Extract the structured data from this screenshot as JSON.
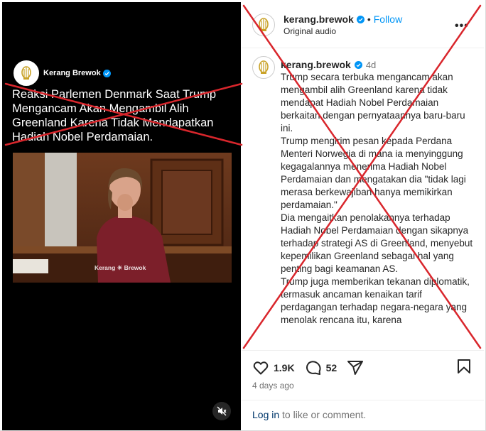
{
  "video": {
    "brand_name": "Kerang Brewok",
    "headline": "Reaksi Parlemen Denmark Saat Trump Mengancam Akan Mengambil Alih Greenland Karena Tidak Mendapatkan Hadiah Nobel Perdamaian.",
    "watermark": "Kerang ☀ Brewok"
  },
  "post": {
    "username": "kerang.brewok",
    "follow_label": "Follow",
    "audio": "Original audio",
    "caption_time": "4d",
    "caption_paragraphs": [
      "Trump secara terbuka mengancam akan mengambil alih Greenland karena tidak mendapat Hadiah Nobel Perdamaian berkaitan dengan pernyataannya baru-baru ini.",
      "Trump mengirim pesan kepada Perdana Menteri Norwegia di mana ia menyinggung kegagalannya menerima Hadiah Nobel Perdamaian dan mengatakan dia \"tidak lagi merasa berkewajiban hanya memikirkan perdamaian.\"",
      "Dia mengaitkan penolakannya terhadap Hadiah Nobel Perdamaian dengan sikapnya terhadap strategi AS di Greenland, menyebut kepemilikan Greenland sebagai hal yang penting bagi keamanan AS.",
      "Trump juga memberikan tekanan diplomatik, termasuk ancaman kenaikan tarif perdagangan terhadap negara-negara yang menolak rencana itu, karena"
    ],
    "likes": "1.9K",
    "comments": "52",
    "date": "4 days ago",
    "login_link": "Log in",
    "login_rest": " to like or comment."
  },
  "colors": {
    "accent": "#0095f6",
    "verified": "#0095f6",
    "cross": "#d9262c"
  }
}
